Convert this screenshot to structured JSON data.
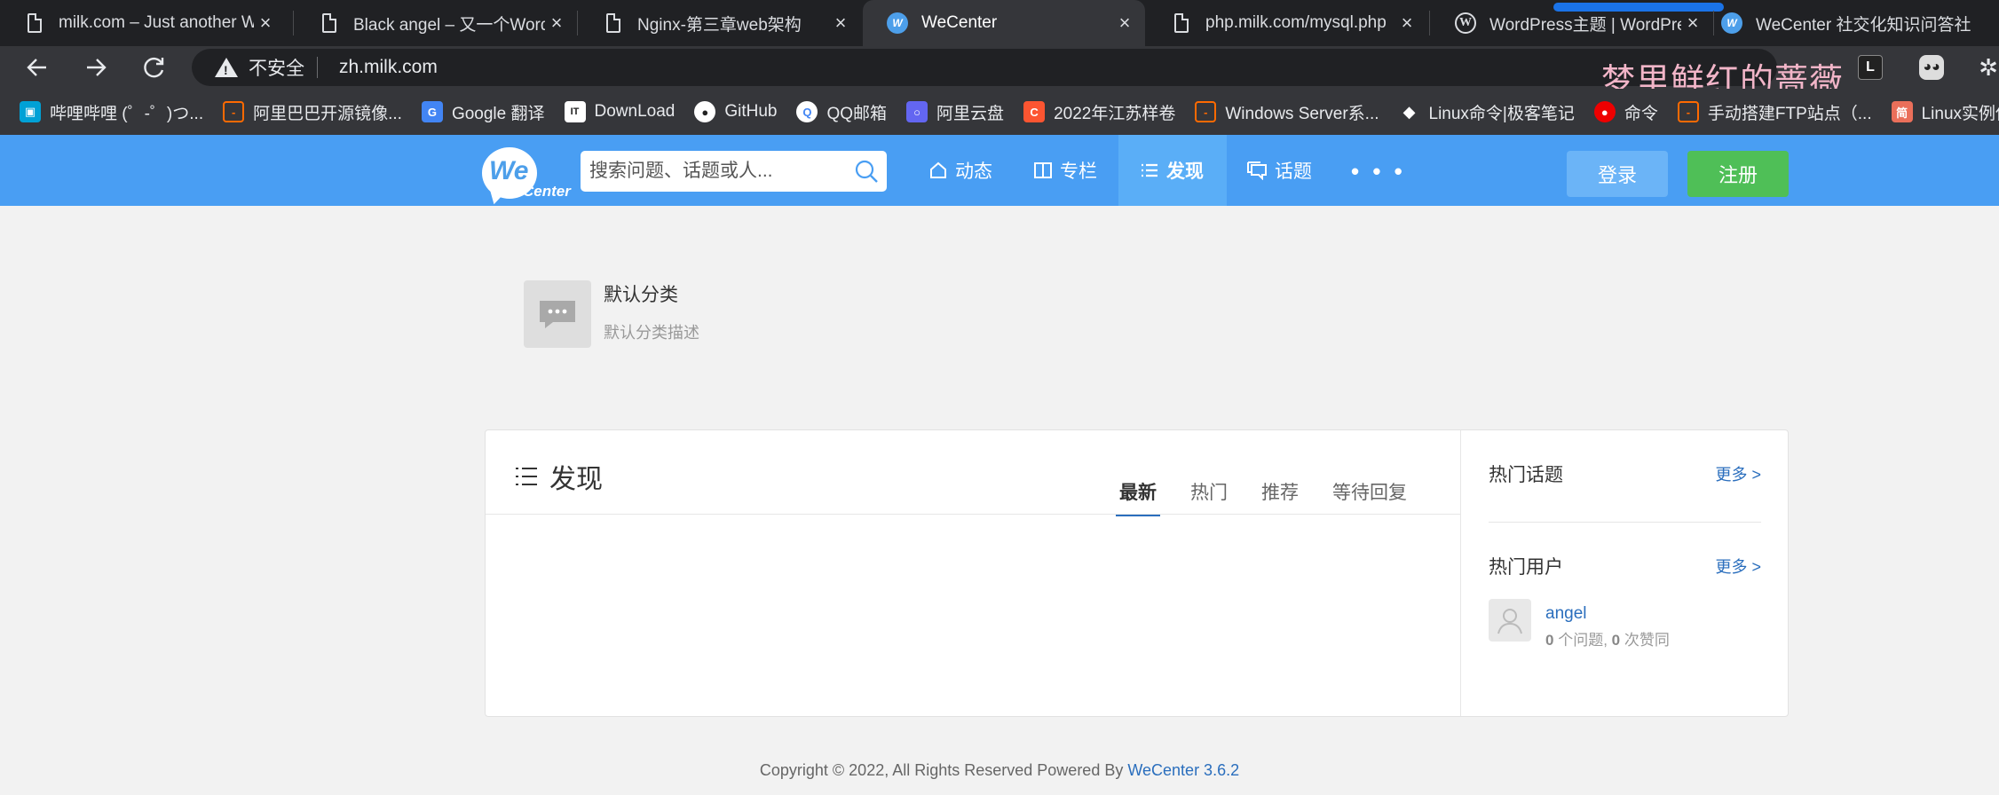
{
  "browser": {
    "tabs": [
      {
        "title": "milk.com – Just another Wo",
        "icon": "page-icon"
      },
      {
        "title": "Black angel – 又一个WordPr",
        "icon": "page-icon"
      },
      {
        "title": "Nginx-第三章web架构",
        "icon": "page-icon"
      },
      {
        "title": "WeCenter",
        "icon": "wecenter-icon",
        "active": true
      },
      {
        "title": "php.milk.com/mysql.php",
        "icon": "page-icon"
      },
      {
        "title": "WordPress主题 | WordPress",
        "icon": "wordpress-icon"
      },
      {
        "title": "WeCenter 社交化知识问答社",
        "icon": "wecenter-icon"
      }
    ],
    "close_glyph": "×",
    "security_label": "不安全",
    "url": "zh.milk.com",
    "watermark": "梦里鲜红的蔷薇",
    "bookmarks": [
      {
        "label": "哔哩哔哩 (゜-゜)つ...",
        "icon": "bilibili-icon",
        "color": "#00a1d6"
      },
      {
        "label": "阿里巴巴开源镜像...",
        "icon": "aliyun-icon",
        "color": "#ff6a00"
      },
      {
        "label": "Google 翻译",
        "icon": "google-translate-icon",
        "color": "#4285f4"
      },
      {
        "label": "DownLoad",
        "icon": "download-icon",
        "color": "#ffffff"
      },
      {
        "label": "GitHub",
        "icon": "github-icon",
        "color": "#ffffff"
      },
      {
        "label": "QQ邮箱",
        "icon": "qq-mail-icon",
        "color": "#f4b400"
      },
      {
        "label": "阿里云盘",
        "icon": "aliyun-drive-icon",
        "color": "#6366f1"
      },
      {
        "label": "2022年江苏样卷",
        "icon": "csdn-icon",
        "color": "#fc5531"
      },
      {
        "label": "Windows Server系...",
        "icon": "aliyun-icon",
        "color": "#ff6a00"
      },
      {
        "label": "Linux命令|极客笔记",
        "icon": "graduation-cap-icon",
        "color": "#ffffff"
      },
      {
        "label": "命令",
        "icon": "redhat-icon",
        "color": "#ee0000"
      },
      {
        "label": "手动搭建FTP站点（...",
        "icon": "aliyun-icon",
        "color": "#ff6a00"
      },
      {
        "label": "Linux实例使用v",
        "icon": "jianshu-icon",
        "color": "#ea6f5a"
      }
    ]
  },
  "site": {
    "logo_we": "We",
    "logo_center": "Center",
    "search_placeholder": "搜索问题、话题或人...",
    "nav": [
      {
        "label": "动态",
        "icon": "home-icon"
      },
      {
        "label": "专栏",
        "icon": "columns-icon"
      },
      {
        "label": "发现",
        "icon": "list-icon",
        "active": true
      },
      {
        "label": "话题",
        "icon": "chat-icon"
      }
    ],
    "more_glyph": "• • •",
    "login_label": "登录",
    "register_label": "注册",
    "category": {
      "name": "默认分类",
      "description": "默认分类描述"
    },
    "discover": {
      "title": "发现",
      "tabs": [
        "最新",
        "热门",
        "推荐",
        "等待回复"
      ],
      "active_tab": "最新"
    },
    "sidebar": {
      "hot_topics_title": "热门话题",
      "hot_topics_more": "更多 >",
      "hot_users_title": "热门用户",
      "hot_users_more": "更多 >",
      "user": {
        "name": "angel",
        "questions": "0",
        "questions_label": "个问题,",
        "votes": "0",
        "votes_label": "次赞同"
      }
    },
    "footer": {
      "text": "Copyright © 2022, All Rights Reserved Powered By",
      "link": "WeCenter 3.6.2"
    }
  },
  "colors": {
    "header": "#499ef3",
    "register": "#4fbf57",
    "link": "#2a6ebd"
  }
}
